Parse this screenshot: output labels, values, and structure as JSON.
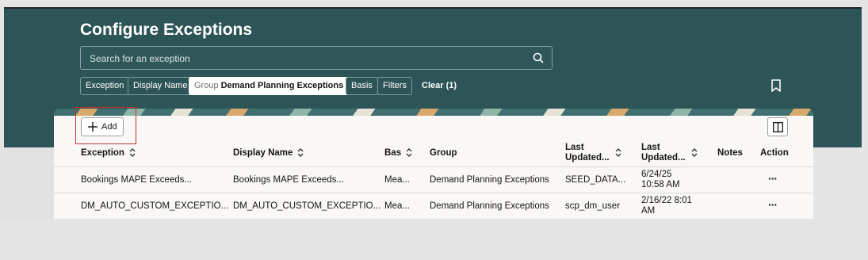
{
  "page": {
    "title": "Configure Exceptions",
    "search_placeholder": "Search for an exception",
    "filters": {
      "exception": "Exception",
      "display_name": "Display Name",
      "group_prefix": "Group",
      "group_value": "Demand Planning Exceptions",
      "basis": "Basis",
      "filters": "Filters",
      "clear": "Clear (1)"
    },
    "toolbar": {
      "add_label": "Add"
    },
    "colors": {
      "header_bg": "#2d5456",
      "panel_bg": "#f9f8f6",
      "highlight": "#c9302c"
    }
  },
  "table": {
    "headers": {
      "exception": "Exception",
      "display_name": "Display Name",
      "basis": "Bas",
      "group": "Group",
      "last_updated_by_1": "Last",
      "last_updated_by_2": "Updated...",
      "last_updated_on_1": "Last",
      "last_updated_on_2": "Updated...",
      "notes": "Notes",
      "action": "Action"
    },
    "rows": [
      {
        "exception": "Bookings MAPE Exceeds...",
        "display_name": "Bookings MAPE Exceeds...",
        "basis": "Mea...",
        "group": "Demand Planning Exceptions",
        "updated_by": "SEED_DATA...",
        "updated_on_1": "6/24/25",
        "updated_on_2": "10:58 AM",
        "notes": "",
        "action": "···"
      },
      {
        "exception": "DM_AUTO_CUSTOM_EXCEPTIO...",
        "display_name": "DM_AUTO_CUSTOM_EXCEPTIO...",
        "basis": "Mea...",
        "group": "Demand Planning Exceptions",
        "updated_by": "scp_dm_user",
        "updated_on_1": "2/16/22 8:01",
        "updated_on_2": "AM",
        "notes": "",
        "action": "···"
      }
    ]
  }
}
